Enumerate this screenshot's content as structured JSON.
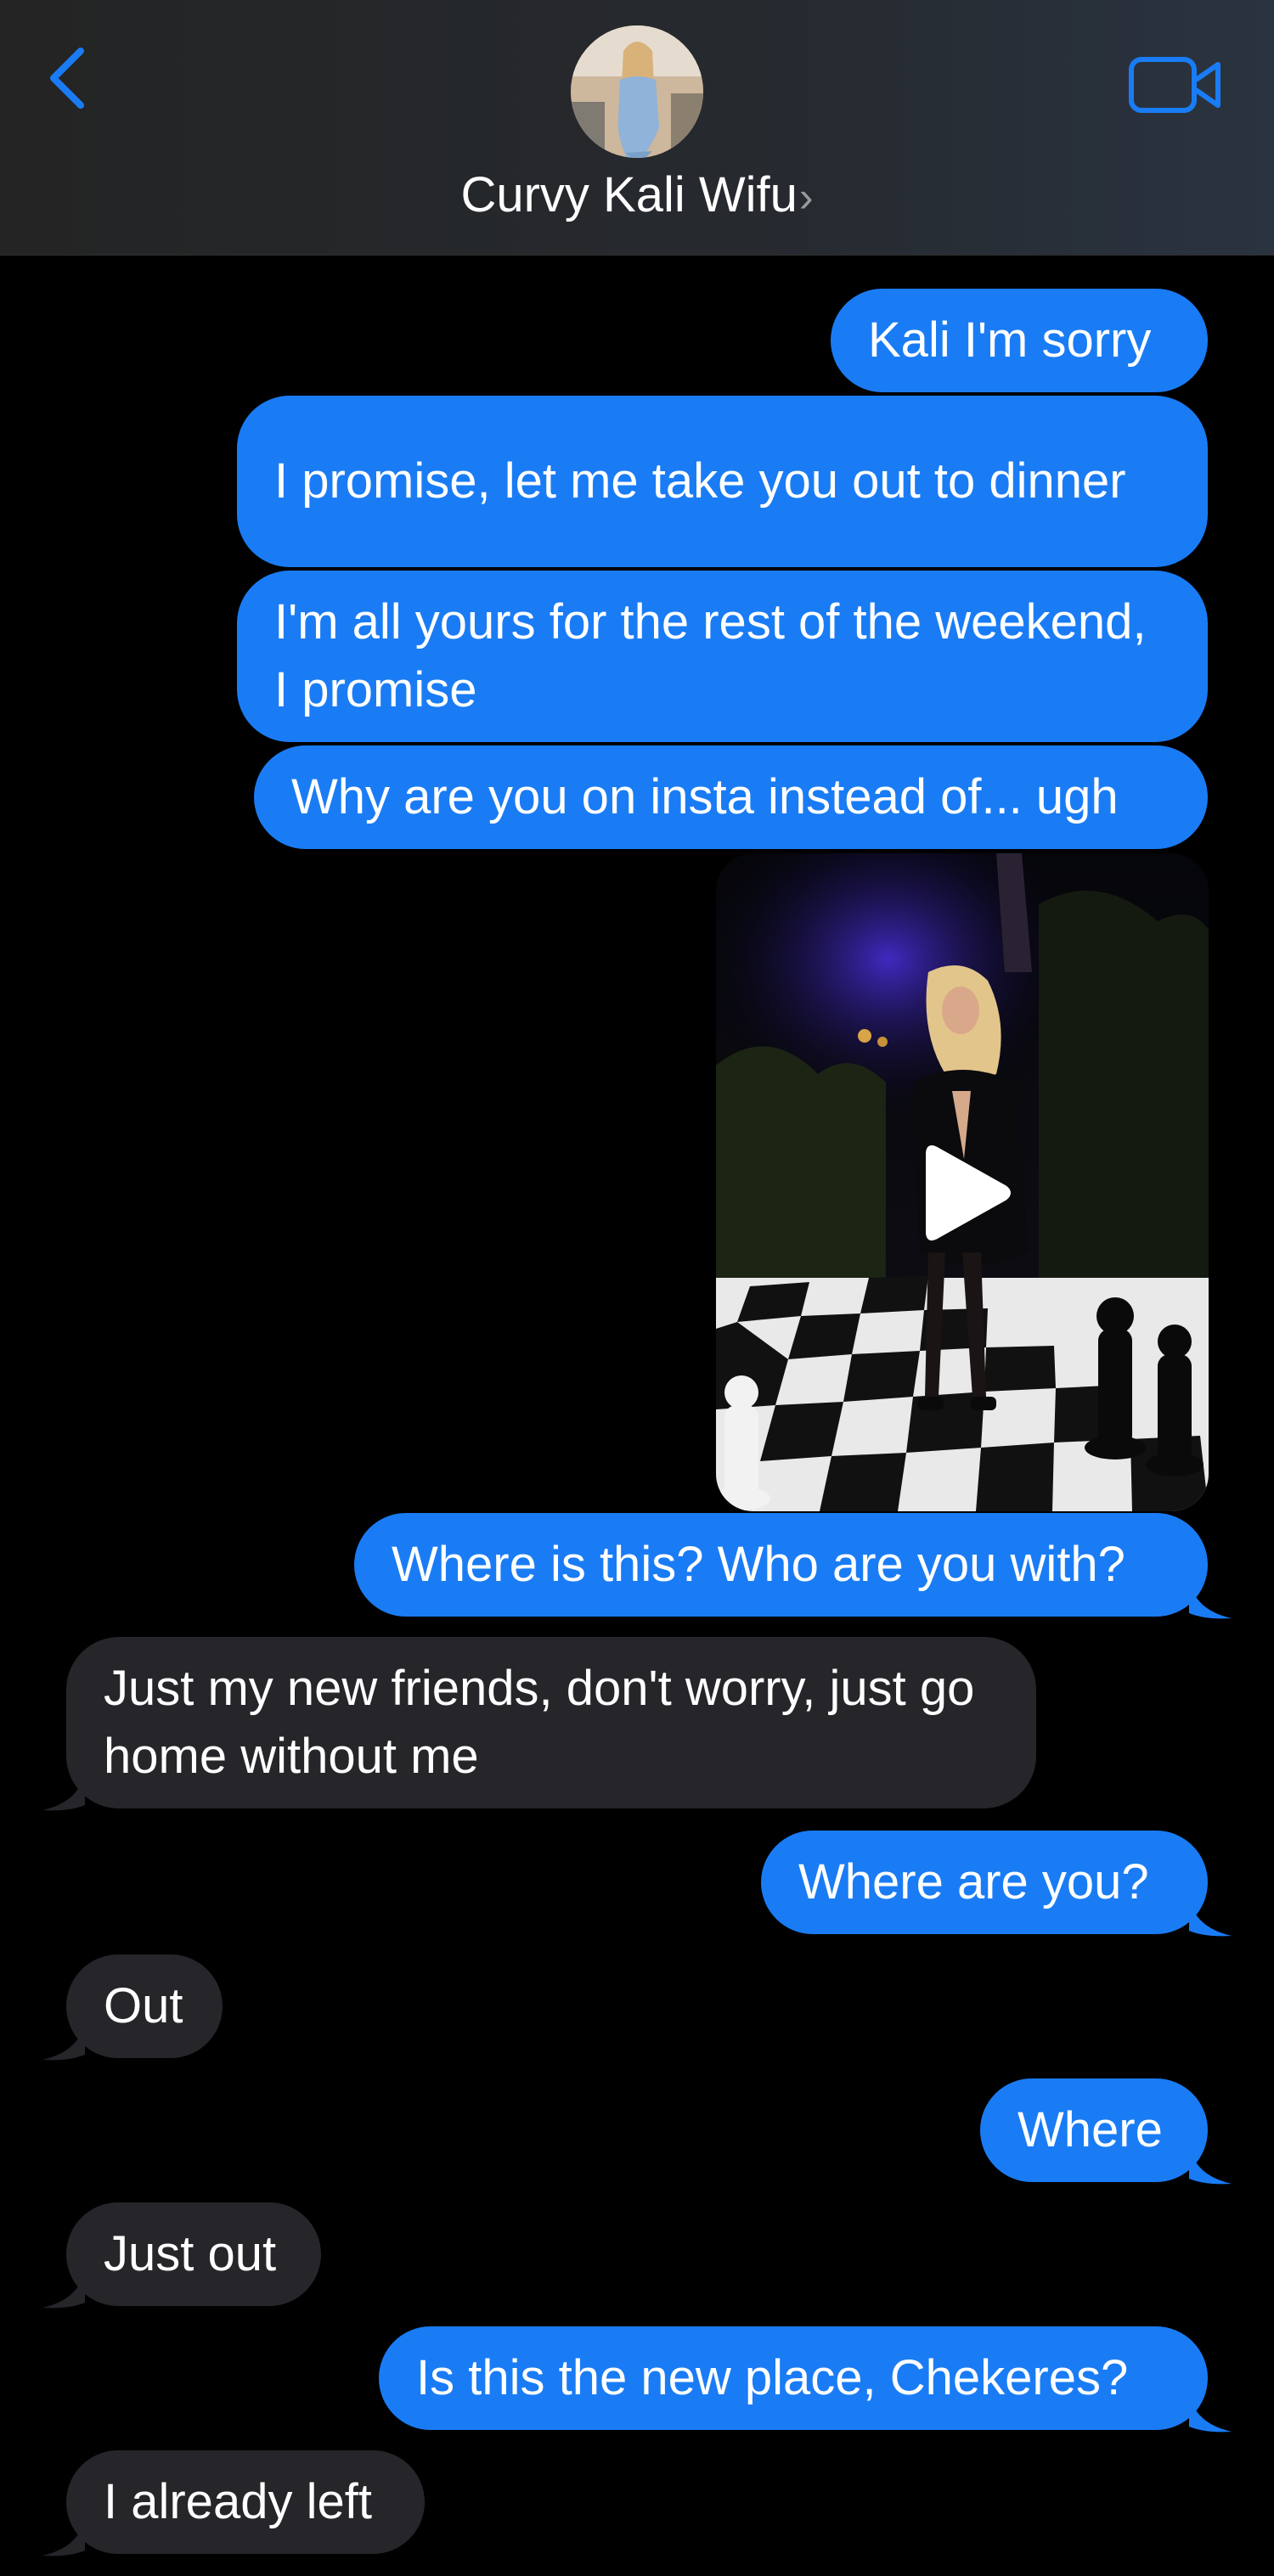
{
  "header": {
    "contact_name": "Curvy Kali Wifu",
    "chevron": "›",
    "back_icon": "chevron-left-icon",
    "video_icon": "video-camera-icon",
    "accent_color": "#1a7cf5"
  },
  "messages": [
    {
      "from": "me",
      "text": "Kali I'm sorry"
    },
    {
      "from": "me",
      "text": "I promise, let me take you out to dinner"
    },
    {
      "from": "me",
      "text": "I'm all yours for the rest of the weekend, I promise"
    },
    {
      "from": "me",
      "text": "Why are you on insta instead of... ugh"
    },
    {
      "from": "me",
      "type": "video",
      "icon": "play-icon"
    },
    {
      "from": "me",
      "text": "Where is this? Who are you with?"
    },
    {
      "from": "them",
      "text": "Just my new friends, don't worry, just go home without me"
    },
    {
      "from": "me",
      "text": "Where are you?"
    },
    {
      "from": "them",
      "text": "Out"
    },
    {
      "from": "me",
      "text": "Where"
    },
    {
      "from": "them",
      "text": "Just out"
    },
    {
      "from": "me",
      "text": "Is this the new place, Chekeres?"
    },
    {
      "from": "them",
      "text": "I already left"
    }
  ],
  "colors": {
    "sent_bubble": "#1a7cf5",
    "received_bubble": "#26252a",
    "background": "#000000"
  }
}
